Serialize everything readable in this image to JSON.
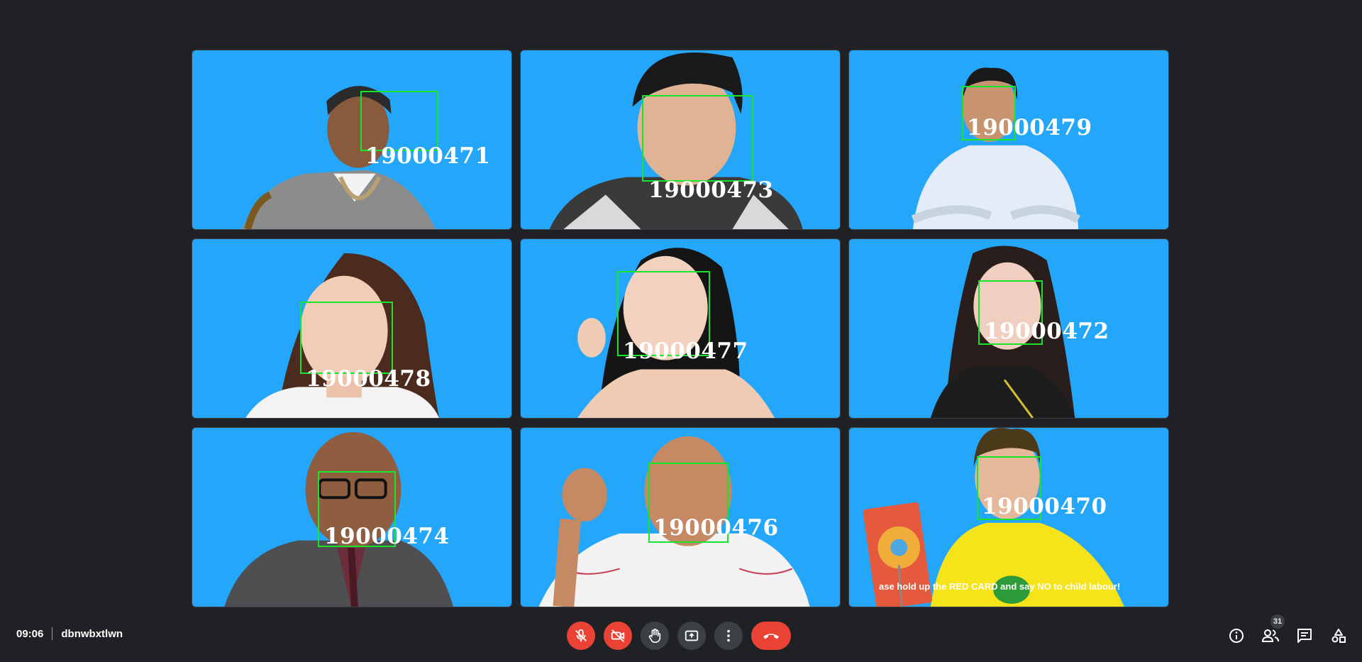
{
  "meeting": {
    "time": "09:06",
    "code": "dbnwbxtlwn"
  },
  "participants_count": "31",
  "tiles": [
    {
      "id": "19000471",
      "caption": ""
    },
    {
      "id": "19000473",
      "caption": ""
    },
    {
      "id": "19000479",
      "caption": ""
    },
    {
      "id": "19000478",
      "caption": ""
    },
    {
      "id": "19000477",
      "caption": ""
    },
    {
      "id": "19000472",
      "caption": ""
    },
    {
      "id": "19000474",
      "caption": ""
    },
    {
      "id": "19000476",
      "caption": ""
    },
    {
      "id": "19000470",
      "caption": "ase hold up the RED CARD and say NO to child labour!"
    }
  ],
  "controls": [
    {
      "name": "mic-off-button",
      "icon": "mic-off-icon"
    },
    {
      "name": "camera-off-button",
      "icon": "camera-off-icon"
    },
    {
      "name": "raise-hand-button",
      "icon": "hand-icon"
    },
    {
      "name": "present-screen-button",
      "icon": "present-icon"
    },
    {
      "name": "more-options-button",
      "icon": "more-vert-icon"
    },
    {
      "name": "leave-call-button",
      "icon": "phone-hangup-icon"
    }
  ],
  "colors": {
    "background": "#202124",
    "tile": "#24a6fb",
    "facebox": "#16e52a",
    "danger": "#ea4335",
    "control": "#3c4043"
  }
}
